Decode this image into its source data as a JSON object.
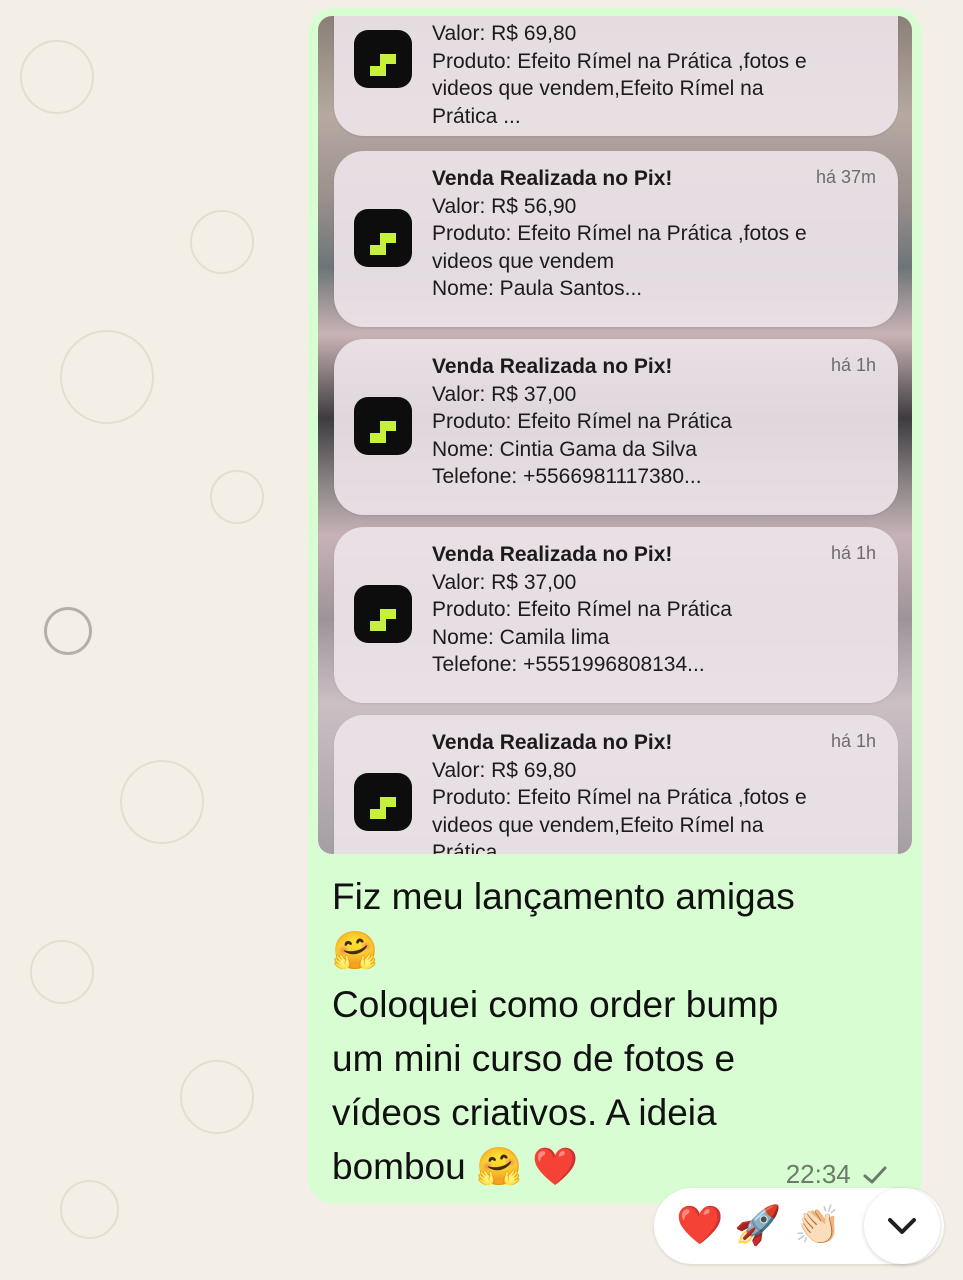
{
  "notifications": [
    {
      "title": "",
      "time": "",
      "lines": [
        "Valor: R$ 69,80",
        "Produto: Efeito Rímel na Prática ,fotos e",
        "videos que vendem,Efeito Rímel na",
        "Prática ..."
      ]
    },
    {
      "title": "Venda Realizada no Pix!",
      "time": "há 37m",
      "lines": [
        "Valor: R$ 56,90",
        "Produto: Efeito Rímel na Prática ,fotos e",
        "videos que vendem",
        "Nome: Paula Santos..."
      ]
    },
    {
      "title": "Venda Realizada no Pix!",
      "time": "há 1h",
      "lines": [
        "Valor: R$ 37,00",
        "Produto: Efeito Rímel na Prática",
        "Nome: Cintia Gama da Silva",
        "Telefone: +5566981117380..."
      ]
    },
    {
      "title": "Venda Realizada no Pix!",
      "time": "há 1h",
      "lines": [
        "Valor: R$ 37,00",
        "Produto: Efeito Rímel na Prática",
        "Nome: Camila lima",
        "Telefone: +5551996808134..."
      ]
    },
    {
      "title": "Venda Realizada no Pix!",
      "time": "há 1h",
      "lines": [
        "Valor: R$ 69,80",
        "Produto: Efeito Rímel na Prática ,fotos e",
        "videos que vendem,Efeito Rímel na",
        "Prática ..."
      ]
    }
  ],
  "message": {
    "line1": "Fiz meu lançamento amigas",
    "emoji_hug": "🤗",
    "line2": "Coloquei como order bump",
    "line3": "um mini curso de fotos e",
    "line4": "vídeos criativos. A ideia",
    "line5": "bombou",
    "emoji_heart": "❤️",
    "time": "22:34",
    "status_icon": "single-check-icon"
  },
  "reactions": [
    "❤️",
    "🚀",
    "👏🏻"
  ],
  "colors": {
    "bubble": "#d9fdd3",
    "wallpaper": "#f3efe6",
    "app_icon_accent": "#c6f03c"
  }
}
